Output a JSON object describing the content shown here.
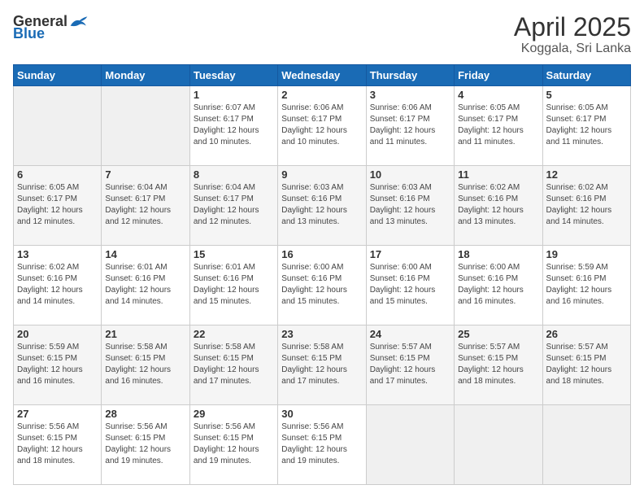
{
  "logo": {
    "general": "General",
    "blue": "Blue"
  },
  "header": {
    "title": "April 2025",
    "subtitle": "Koggala, Sri Lanka"
  },
  "calendar": {
    "days_of_week": [
      "Sunday",
      "Monday",
      "Tuesday",
      "Wednesday",
      "Thursday",
      "Friday",
      "Saturday"
    ],
    "weeks": [
      [
        {
          "day": "",
          "sunrise": "",
          "sunset": "",
          "daylight": ""
        },
        {
          "day": "",
          "sunrise": "",
          "sunset": "",
          "daylight": ""
        },
        {
          "day": "1",
          "sunrise": "Sunrise: 6:07 AM",
          "sunset": "Sunset: 6:17 PM",
          "daylight": "Daylight: 12 hours and 10 minutes."
        },
        {
          "day": "2",
          "sunrise": "Sunrise: 6:06 AM",
          "sunset": "Sunset: 6:17 PM",
          "daylight": "Daylight: 12 hours and 10 minutes."
        },
        {
          "day": "3",
          "sunrise": "Sunrise: 6:06 AM",
          "sunset": "Sunset: 6:17 PM",
          "daylight": "Daylight: 12 hours and 11 minutes."
        },
        {
          "day": "4",
          "sunrise": "Sunrise: 6:05 AM",
          "sunset": "Sunset: 6:17 PM",
          "daylight": "Daylight: 12 hours and 11 minutes."
        },
        {
          "day": "5",
          "sunrise": "Sunrise: 6:05 AM",
          "sunset": "Sunset: 6:17 PM",
          "daylight": "Daylight: 12 hours and 11 minutes."
        }
      ],
      [
        {
          "day": "6",
          "sunrise": "Sunrise: 6:05 AM",
          "sunset": "Sunset: 6:17 PM",
          "daylight": "Daylight: 12 hours and 12 minutes."
        },
        {
          "day": "7",
          "sunrise": "Sunrise: 6:04 AM",
          "sunset": "Sunset: 6:17 PM",
          "daylight": "Daylight: 12 hours and 12 minutes."
        },
        {
          "day": "8",
          "sunrise": "Sunrise: 6:04 AM",
          "sunset": "Sunset: 6:17 PM",
          "daylight": "Daylight: 12 hours and 12 minutes."
        },
        {
          "day": "9",
          "sunrise": "Sunrise: 6:03 AM",
          "sunset": "Sunset: 6:16 PM",
          "daylight": "Daylight: 12 hours and 13 minutes."
        },
        {
          "day": "10",
          "sunrise": "Sunrise: 6:03 AM",
          "sunset": "Sunset: 6:16 PM",
          "daylight": "Daylight: 12 hours and 13 minutes."
        },
        {
          "day": "11",
          "sunrise": "Sunrise: 6:02 AM",
          "sunset": "Sunset: 6:16 PM",
          "daylight": "Daylight: 12 hours and 13 minutes."
        },
        {
          "day": "12",
          "sunrise": "Sunrise: 6:02 AM",
          "sunset": "Sunset: 6:16 PM",
          "daylight": "Daylight: 12 hours and 14 minutes."
        }
      ],
      [
        {
          "day": "13",
          "sunrise": "Sunrise: 6:02 AM",
          "sunset": "Sunset: 6:16 PM",
          "daylight": "Daylight: 12 hours and 14 minutes."
        },
        {
          "day": "14",
          "sunrise": "Sunrise: 6:01 AM",
          "sunset": "Sunset: 6:16 PM",
          "daylight": "Daylight: 12 hours and 14 minutes."
        },
        {
          "day": "15",
          "sunrise": "Sunrise: 6:01 AM",
          "sunset": "Sunset: 6:16 PM",
          "daylight": "Daylight: 12 hours and 15 minutes."
        },
        {
          "day": "16",
          "sunrise": "Sunrise: 6:00 AM",
          "sunset": "Sunset: 6:16 PM",
          "daylight": "Daylight: 12 hours and 15 minutes."
        },
        {
          "day": "17",
          "sunrise": "Sunrise: 6:00 AM",
          "sunset": "Sunset: 6:16 PM",
          "daylight": "Daylight: 12 hours and 15 minutes."
        },
        {
          "day": "18",
          "sunrise": "Sunrise: 6:00 AM",
          "sunset": "Sunset: 6:16 PM",
          "daylight": "Daylight: 12 hours and 16 minutes."
        },
        {
          "day": "19",
          "sunrise": "Sunrise: 5:59 AM",
          "sunset": "Sunset: 6:16 PM",
          "daylight": "Daylight: 12 hours and 16 minutes."
        }
      ],
      [
        {
          "day": "20",
          "sunrise": "Sunrise: 5:59 AM",
          "sunset": "Sunset: 6:15 PM",
          "daylight": "Daylight: 12 hours and 16 minutes."
        },
        {
          "day": "21",
          "sunrise": "Sunrise: 5:58 AM",
          "sunset": "Sunset: 6:15 PM",
          "daylight": "Daylight: 12 hours and 16 minutes."
        },
        {
          "day": "22",
          "sunrise": "Sunrise: 5:58 AM",
          "sunset": "Sunset: 6:15 PM",
          "daylight": "Daylight: 12 hours and 17 minutes."
        },
        {
          "day": "23",
          "sunrise": "Sunrise: 5:58 AM",
          "sunset": "Sunset: 6:15 PM",
          "daylight": "Daylight: 12 hours and 17 minutes."
        },
        {
          "day": "24",
          "sunrise": "Sunrise: 5:57 AM",
          "sunset": "Sunset: 6:15 PM",
          "daylight": "Daylight: 12 hours and 17 minutes."
        },
        {
          "day": "25",
          "sunrise": "Sunrise: 5:57 AM",
          "sunset": "Sunset: 6:15 PM",
          "daylight": "Daylight: 12 hours and 18 minutes."
        },
        {
          "day": "26",
          "sunrise": "Sunrise: 5:57 AM",
          "sunset": "Sunset: 6:15 PM",
          "daylight": "Daylight: 12 hours and 18 minutes."
        }
      ],
      [
        {
          "day": "27",
          "sunrise": "Sunrise: 5:56 AM",
          "sunset": "Sunset: 6:15 PM",
          "daylight": "Daylight: 12 hours and 18 minutes."
        },
        {
          "day": "28",
          "sunrise": "Sunrise: 5:56 AM",
          "sunset": "Sunset: 6:15 PM",
          "daylight": "Daylight: 12 hours and 19 minutes."
        },
        {
          "day": "29",
          "sunrise": "Sunrise: 5:56 AM",
          "sunset": "Sunset: 6:15 PM",
          "daylight": "Daylight: 12 hours and 19 minutes."
        },
        {
          "day": "30",
          "sunrise": "Sunrise: 5:56 AM",
          "sunset": "Sunset: 6:15 PM",
          "daylight": "Daylight: 12 hours and 19 minutes."
        },
        {
          "day": "",
          "sunrise": "",
          "sunset": "",
          "daylight": ""
        },
        {
          "day": "",
          "sunrise": "",
          "sunset": "",
          "daylight": ""
        },
        {
          "day": "",
          "sunrise": "",
          "sunset": "",
          "daylight": ""
        }
      ]
    ]
  }
}
